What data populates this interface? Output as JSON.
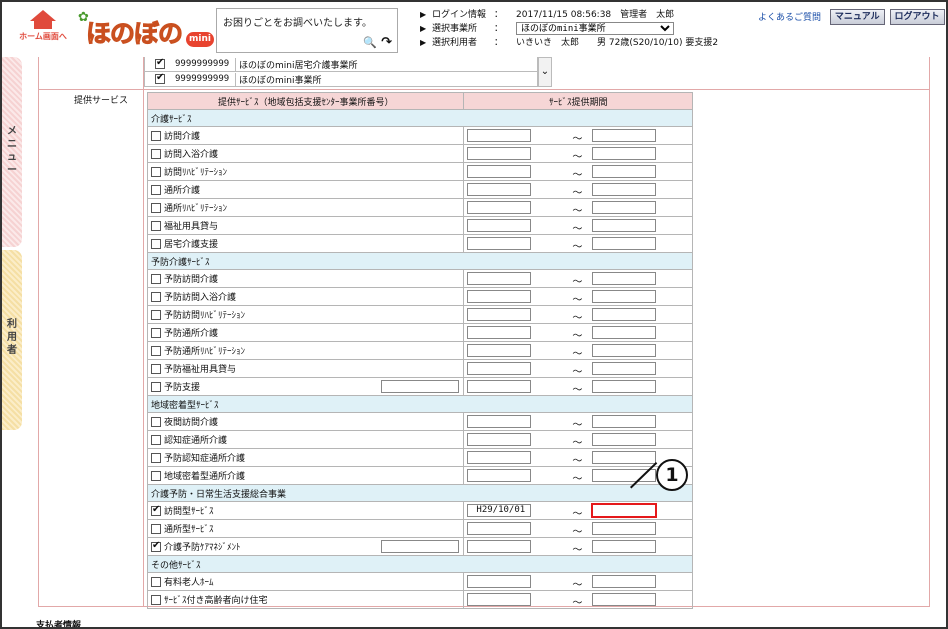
{
  "header": {
    "home_label": "ホーム画面へ",
    "logo_text": "ほのぼの",
    "logo_badge": "mini",
    "search_placeholder": "お困りごとをお調べいたします。",
    "login_label": "ログイン情報",
    "login_value": "2017/11/15 08:56:38　管理者　太郎",
    "office_label": "選択事業所",
    "office_selected": "ほのぼのmini事業所",
    "user_label": "選択利用者",
    "user_name": "いきいき　太郎",
    "user_detail": "男 72歳(S20/10/10) 要支援2",
    "faq": "よくあるご質問",
    "manual": "マニュアル",
    "logout": "ログアウト"
  },
  "side_tabs": {
    "menu": [
      "メ",
      "ニ",
      "ュ",
      "ー"
    ],
    "user": [
      "利",
      "用",
      "者"
    ]
  },
  "office_rows": [
    {
      "checked": true,
      "code": "9999999999",
      "name": "ほのぼのmini居宅介護事業所"
    },
    {
      "checked": true,
      "code": "9999999999",
      "name": "ほのぼのmini事業所"
    }
  ],
  "section_label": "提供サービス",
  "table_headers": {
    "service": "提供ｻｰﾋﾞｽ（地域包括支援ｾﾝﾀｰ事業所番号）",
    "period": "ｻｰﾋﾞｽ提供期間"
  },
  "categories": [
    {
      "title": "介護ｻｰﾋﾞｽ",
      "items": [
        {
          "name": "訪問介護",
          "checked": false,
          "start": "",
          "end": ""
        },
        {
          "name": "訪問入浴介護",
          "checked": false,
          "start": "",
          "end": ""
        },
        {
          "name": "訪問ﾘﾊﾋﾞﾘﾃｰｼｮﾝ",
          "checked": false,
          "start": "",
          "end": ""
        },
        {
          "name": "通所介護",
          "checked": false,
          "start": "",
          "end": ""
        },
        {
          "name": "通所ﾘﾊﾋﾞﾘﾃｰｼｮﾝ",
          "checked": false,
          "start": "",
          "end": ""
        },
        {
          "name": "福祉用具貸与",
          "checked": false,
          "start": "",
          "end": ""
        },
        {
          "name": "居宅介護支援",
          "checked": false,
          "start": "",
          "end": ""
        }
      ]
    },
    {
      "title": "予防介護ｻｰﾋﾞｽ",
      "items": [
        {
          "name": "予防訪問介護",
          "checked": false,
          "start": "",
          "end": ""
        },
        {
          "name": "予防訪問入浴介護",
          "checked": false,
          "start": "",
          "end": ""
        },
        {
          "name": "予防訪問ﾘﾊﾋﾞﾘﾃｰｼｮﾝ",
          "checked": false,
          "start": "",
          "end": ""
        },
        {
          "name": "予防通所介護",
          "checked": false,
          "start": "",
          "end": ""
        },
        {
          "name": "予防通所ﾘﾊﾋﾞﾘﾃｰｼｮﾝ",
          "checked": false,
          "start": "",
          "end": ""
        },
        {
          "name": "予防福祉用具貸与",
          "checked": false,
          "start": "",
          "end": ""
        },
        {
          "name": "予防支援",
          "checked": false,
          "start": "",
          "end": "",
          "has_code": true
        }
      ]
    },
    {
      "title": "地域密着型ｻｰﾋﾞｽ",
      "items": [
        {
          "name": "夜間訪問介護",
          "checked": false,
          "start": "",
          "end": ""
        },
        {
          "name": "認知症通所介護",
          "checked": false,
          "start": "",
          "end": ""
        },
        {
          "name": "予防認知症通所介護",
          "checked": false,
          "start": "",
          "end": ""
        },
        {
          "name": "地域密着型通所介護",
          "checked": false,
          "start": "",
          "end": ""
        }
      ]
    },
    {
      "title": "介護予防・日常生活支援総合事業",
      "items": [
        {
          "name": "訪問型ｻｰﾋﾞｽ",
          "checked": true,
          "start": "H29/10/01",
          "end": "",
          "highlight": true
        },
        {
          "name": "通所型ｻｰﾋﾞｽ",
          "checked": false,
          "start": "",
          "end": ""
        },
        {
          "name": "介護予防ｹｱﾏﾈｼﾞﾒﾝﾄ",
          "checked": true,
          "start": "",
          "end": "",
          "has_code": true
        }
      ]
    },
    {
      "title": "その他ｻｰﾋﾞｽ",
      "items": [
        {
          "name": "有料老人ﾎｰﾑ",
          "checked": false,
          "start": "",
          "end": ""
        },
        {
          "name": "ｻｰﾋﾞｽ付き高齢者向け住宅",
          "checked": false,
          "start": "",
          "end": ""
        }
      ]
    }
  ],
  "tilde": "～",
  "callout_number": "1",
  "footer_label": "支払者情報",
  "colors": {
    "highlight": "#e5191b",
    "header_bg": "#f6d6d6",
    "category_bg": "#dff1f7",
    "brand": "#e8732f"
  }
}
